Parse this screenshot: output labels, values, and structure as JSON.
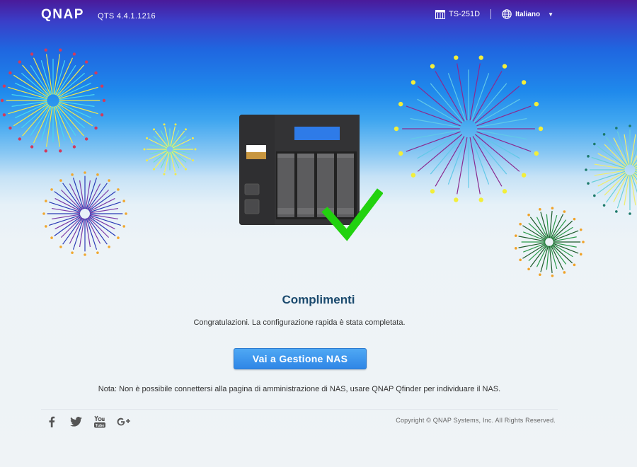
{
  "header": {
    "logo_text": "QNAP",
    "version": "QTS 4.4.1.1216",
    "device_name": "TS-251D",
    "language": "Italiano"
  },
  "main": {
    "title": "Complimenti",
    "subtitle": "Congratulazioni. La configurazione rapida è stata completata.",
    "cta_label": "Vai a Gestione NAS",
    "note": "Nota: Non è possibile connettersi alla pagina di amministrazione di NAS, usare QNAP Qfinder per individuare il NAS."
  },
  "footer": {
    "social": [
      "facebook-icon",
      "twitter-icon",
      "youtube-icon",
      "google-plus-icon"
    ],
    "copyright": "Copyright © QNAP Systems, Inc. All Rights Reserved."
  },
  "colors": {
    "header_purple": "#4a1a9a",
    "sky_blue": "#1f8aec",
    "button_blue": "#3a92ea",
    "title_color": "#1b4a6e",
    "checkmark_green": "#22d20f"
  }
}
